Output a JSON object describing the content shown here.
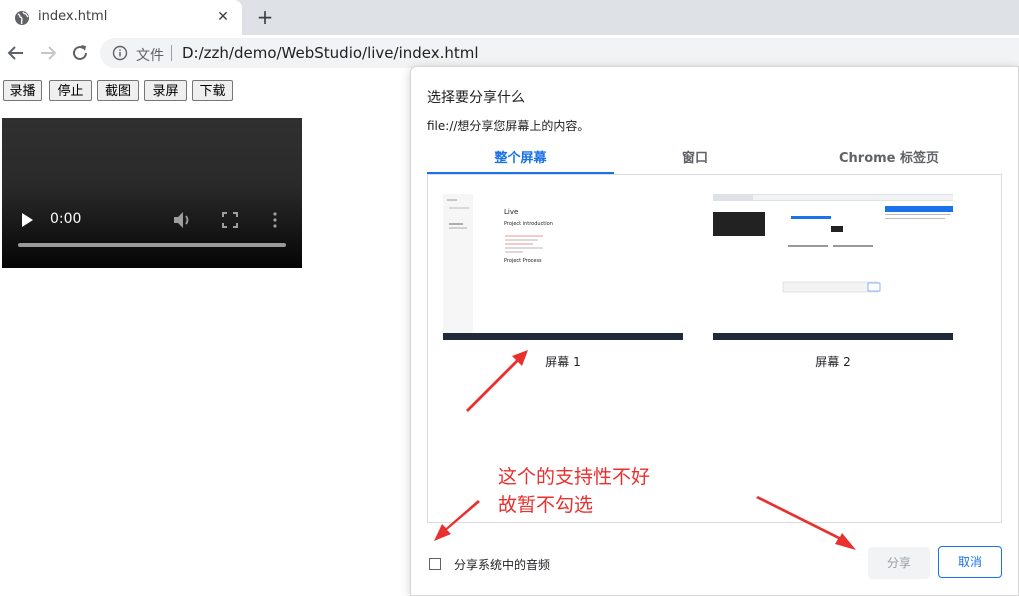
{
  "browser": {
    "tab_title": "index.html",
    "tab_close_icon": "✕",
    "new_tab_icon": "+",
    "scheme_label": "文件",
    "url": "D:/zzh/demo/WebStudio/live/index.html"
  },
  "page": {
    "buttons": [
      "录播",
      "停止",
      "截图",
      "录屏",
      "下载"
    ],
    "video": {
      "time": "0:00"
    }
  },
  "dialog": {
    "title": "选择要分享什么",
    "subtitle": "file://想分享您屏幕上的内容。",
    "tabs": [
      "整个屏幕",
      "窗口",
      "Chrome 标签页"
    ],
    "active_tab": "整个屏幕",
    "screens": [
      "屏幕 1",
      "屏幕 2"
    ],
    "thumb1_text": {
      "line1": "Live",
      "line2": "Project introduction",
      "line3": "Project Process"
    },
    "audio_label": "分享系统中的音频",
    "audio_checked": false,
    "share_label": "分享",
    "cancel_label": "取消"
  },
  "annotation": {
    "line1": "这个的支持性不好",
    "line2": "故暂不勾选"
  },
  "colors": {
    "accent": "#1a73e8",
    "annotation": "#e8312f"
  }
}
